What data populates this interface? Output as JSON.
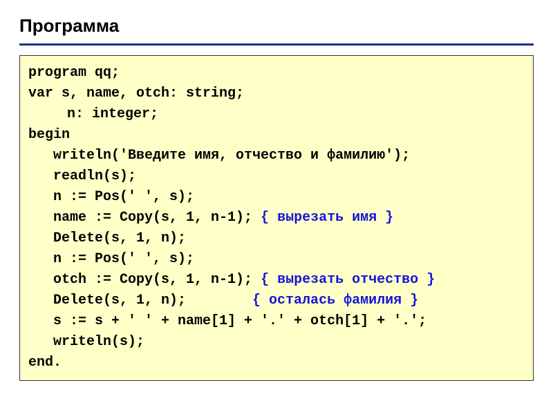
{
  "title": "Программа",
  "code": {
    "l1": "program qq;",
    "l2": "var s, name, otch: string;",
    "l3": "n: integer;",
    "l4": "begin",
    "l5": "writeln('Введите имя, отчество и фамилию');",
    "l6": "readln(s);",
    "l7": "n := Pos(' ', s);",
    "l8a": "name := Copy(s, 1, n-1); ",
    "l8c": "{ вырезать имя }",
    "l9": "Delete(s, 1, n);",
    "l10": "n := Pos(' ', s);",
    "l11a": "otch := Copy(s, 1, n-1); ",
    "l11c": "{ вырезать отчество }",
    "l12a": "Delete(s, 1, n);        ",
    "l12c": "{ осталась фамилия }",
    "l13": "s := s + ' ' + name[1] + '.' + otch[1] + '.';",
    "l14": "writeln(s);",
    "l15": "end."
  }
}
